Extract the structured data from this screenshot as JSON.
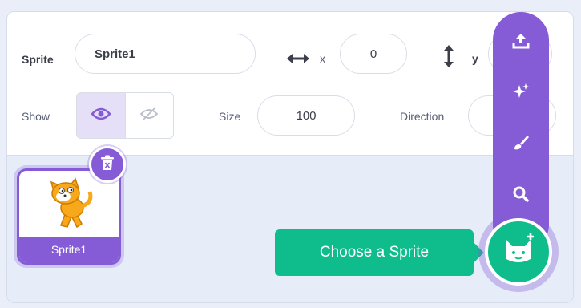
{
  "sprite_info": {
    "sprite_label": "Sprite",
    "sprite_name": "Sprite1",
    "x_label": "x",
    "x_value": "0",
    "y_label": "y",
    "y_value": "",
    "show_label": "Show",
    "size_label": "Size",
    "size_value": "100",
    "direction_label": "Direction",
    "direction_value": ""
  },
  "sprite_list": {
    "sprites": [
      {
        "name": "Sprite1",
        "selected": true
      }
    ]
  },
  "sprite_menu": {
    "items": [
      "upload-icon",
      "surprise-icon",
      "paint-icon",
      "search-icon"
    ],
    "tooltip": "Choose a Sprite"
  },
  "colors": {
    "purple": "#855cd6",
    "green": "#0fbd8c",
    "pane_bg": "#e6edf8"
  }
}
